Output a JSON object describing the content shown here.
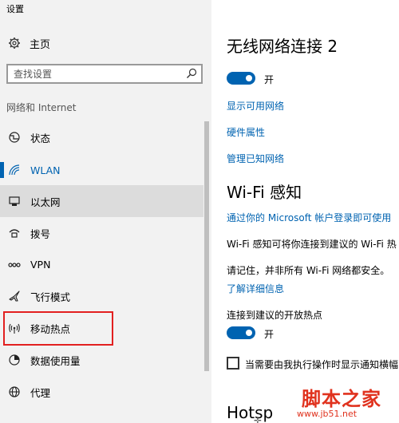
{
  "window": {
    "title": "设置"
  },
  "sidebar": {
    "home_label": "主页",
    "search": {
      "placeholder": "查找设置"
    },
    "section_header": "网络和 Internet",
    "items": [
      {
        "label": "状态",
        "icon": "globe-status-icon"
      },
      {
        "label": "WLAN",
        "icon": "wifi-icon",
        "selected": true
      },
      {
        "label": "以太网",
        "icon": "ethernet-icon"
      },
      {
        "label": "拨号",
        "icon": "dialup-icon"
      },
      {
        "label": "VPN",
        "icon": "vpn-icon"
      },
      {
        "label": "飞行模式",
        "icon": "airplane-icon"
      },
      {
        "label": "移动热点",
        "icon": "hotspot-icon"
      },
      {
        "label": "数据使用量",
        "icon": "data-usage-icon"
      },
      {
        "label": "代理",
        "icon": "proxy-icon"
      }
    ]
  },
  "main": {
    "heading": "无线网络连接 2",
    "wifi_toggle": {
      "state_label": "开",
      "on": true
    },
    "links": {
      "show_networks": "显示可用网络",
      "hardware_properties": "硬件属性",
      "manage_known": "管理已知网络"
    },
    "wifi_sense": {
      "heading": "Wi-Fi 感知",
      "signin_link": "通过你的 Microsoft 帐户登录即可使用",
      "description": "Wi-Fi 感知可将你连接到建议的 Wi-Fi 热",
      "note": "请记住，并非所有 Wi-Fi 网络都安全。",
      "learn_more": "了解详细信息",
      "hotspot_label": "连接到建议的开放热点",
      "hotspot_toggle": {
        "state_label": "开",
        "on": true
      },
      "notify_checkbox_label": "当需要由我执行操作时显示通知横幅"
    },
    "hotspot_heading": "Hotsp"
  },
  "watermark": {
    "main": "脚本之家",
    "url": "www.jb51.net"
  },
  "colors": {
    "accent": "#0063b1",
    "sidebar_bg": "#f2f2f2",
    "highlight_box": "#e22020",
    "watermark": "#e0321e"
  }
}
